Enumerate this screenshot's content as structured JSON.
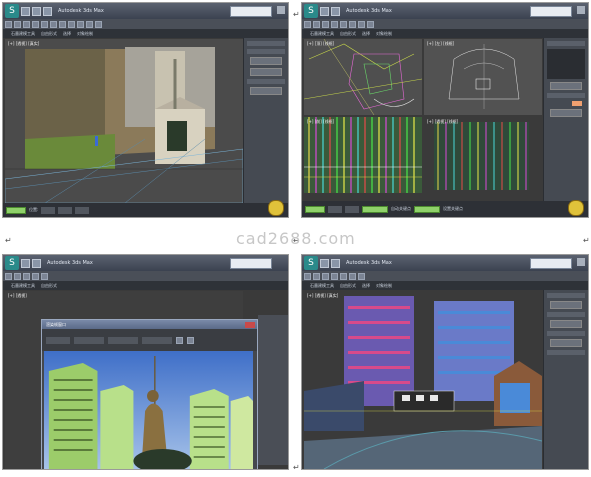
{
  "page": {
    "watermark": "cad2688.com",
    "return_mark": "↵"
  },
  "screenshots": [
    {
      "title": "Autodesk 3ds Max",
      "menu": [
        "石墨建模工具",
        "自由形式",
        "选择",
        "对象绘制"
      ],
      "viewport_label": "[+] [透视] [真实]",
      "status_left": "位置:",
      "colors": {
        "accent": "#8fd16a"
      }
    },
    {
      "title": "Autodesk 3ds Max",
      "menu": [
        "石墨建模工具",
        "自由形式",
        "选择",
        "对象绘制"
      ],
      "viewport_labels": [
        "[+] [顶] [线框]",
        "[+] [左] [线框]",
        "[+] [前] [线框]",
        "[+] [透视] [线框]"
      ],
      "play_label": "自动关键点",
      "key_label": "设置关键点",
      "colors": {
        "accent": "#8fd16a"
      }
    },
    {
      "title": "Autodesk 3ds Max",
      "menu": [
        "石墨建模工具",
        "自由形式"
      ],
      "dialog_title": "渲染帧窗口",
      "viewport_label": "[+] [透视]",
      "colors": {
        "sky": "#5f8fd6"
      }
    },
    {
      "title": "Autodesk 3ds Max",
      "menu": [
        "石墨建模工具",
        "自由形式",
        "选择",
        "对象绘制"
      ],
      "viewport_label": "[+] [透视] [真实]",
      "colors": {
        "accent": "#6a8ad0"
      }
    }
  ]
}
